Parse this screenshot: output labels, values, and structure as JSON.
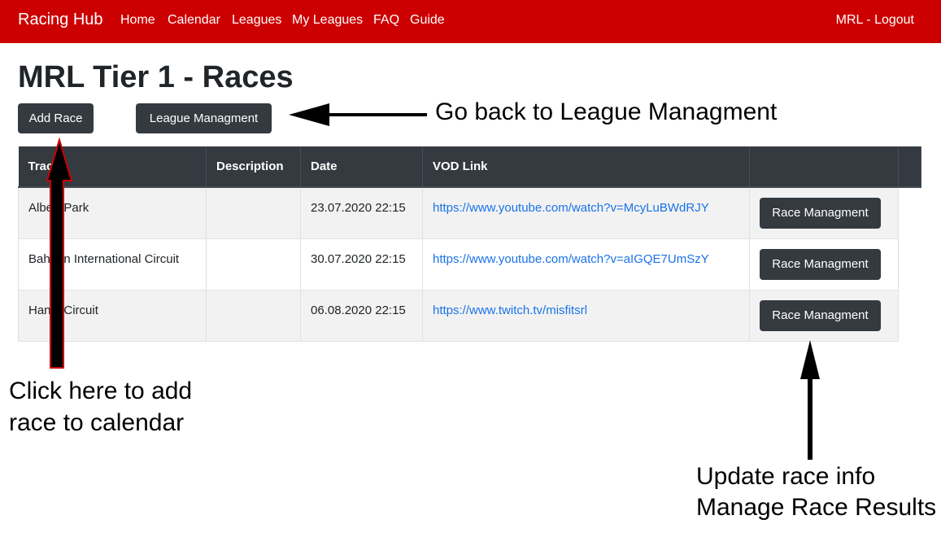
{
  "navbar": {
    "brand": "Racing Hub",
    "links": [
      "Home",
      "Calendar",
      "Leagues",
      "My Leagues",
      "FAQ",
      "Guide"
    ],
    "logout": "MRL - Logout",
    "color": "#cc0000"
  },
  "page": {
    "title": "MRL Tier 1 - Races",
    "add_race_label": "Add Race",
    "league_mgmt_label": "League Managment"
  },
  "table": {
    "headers": [
      "Track",
      "Description",
      "Date",
      "VOD Link",
      ""
    ],
    "rows": [
      {
        "track": "Albert Park",
        "description": "",
        "date": "23.07.2020 22:15",
        "vod": "https://www.youtube.com/watch?v=McyLuBWdRJY",
        "action": "Race Managment"
      },
      {
        "track": "Bahrain International Circuit",
        "description": "",
        "date": "30.07.2020 22:15",
        "vod": "https://www.youtube.com/watch?v=aIGQE7UmSzY",
        "action": "Race Managment"
      },
      {
        "track": "Hanoi Circuit",
        "description": "",
        "date": "06.08.2020 22:15",
        "vod": "https://www.twitch.tv/misfitsrl",
        "action": "Race Managment"
      }
    ]
  },
  "annotations": {
    "league_back": "Go back to League Managment",
    "add_race_line1": "Click here to add",
    "add_race_line2": "race to calendar",
    "update_line1": "Update race info",
    "update_line2": "Manage Race Results"
  }
}
